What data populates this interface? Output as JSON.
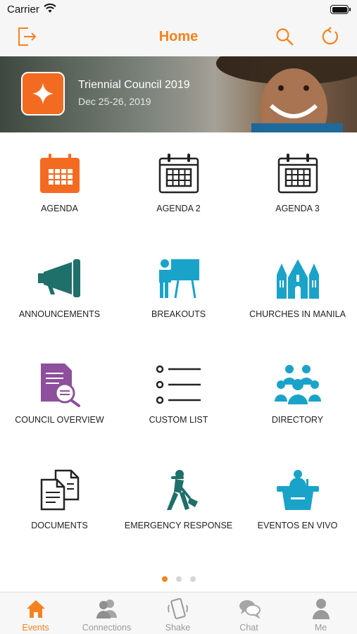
{
  "status_bar": {
    "carrier": "Carrier"
  },
  "nav": {
    "title": "Home"
  },
  "banner": {
    "title": "Triennial Council 2019",
    "date": "Dec 25-26, 2019"
  },
  "tiles": [
    {
      "label": "AGENDA",
      "icon": "calendar-icon",
      "color": "#f36b21"
    },
    {
      "label": "AGENDA 2",
      "icon": "calendar-icon",
      "color": "#222222"
    },
    {
      "label": "AGENDA 3",
      "icon": "calendar-icon",
      "color": "#222222"
    },
    {
      "label": "ANNOUNCEMENTS",
      "icon": "megaphone-icon",
      "color": "#1f6f6b"
    },
    {
      "label": "BREAKOUTS",
      "icon": "presenter-board-icon",
      "color": "#1aa3c9"
    },
    {
      "label": "CHURCHES IN MANILA",
      "icon": "cathedral-icon",
      "color": "#1aa3c9"
    },
    {
      "label": "COUNCIL OVERVIEW",
      "icon": "document-search-icon",
      "color": "#8e4f9c"
    },
    {
      "label": "CUSTOM LIST",
      "icon": "list-icon",
      "color": "#222222"
    },
    {
      "label": "DIRECTORY",
      "icon": "group-icon",
      "color": "#1aa3c9"
    },
    {
      "label": "DOCUMENTS",
      "icon": "documents-icon",
      "color": "#222222"
    },
    {
      "label": "EMERGENCY RESPONSE",
      "icon": "worker-shovel-icon",
      "color": "#1f6f6b"
    },
    {
      "label": "EVENTOS EN VIVO",
      "icon": "podium-icon",
      "color": "#1aa3c9"
    }
  ],
  "pager": {
    "count": 3,
    "active": 1
  },
  "tabs": [
    {
      "label": "Events",
      "icon": "house-icon"
    },
    {
      "label": "Connections",
      "icon": "people-icon"
    },
    {
      "label": "Shake",
      "icon": "shake-phone-icon"
    },
    {
      "label": "Chat",
      "icon": "chat-bubbles-icon"
    },
    {
      "label": "Me",
      "icon": "person-icon"
    }
  ],
  "colors": {
    "accent": "#f5821f",
    "tab_inactive": "#9a9a9a"
  }
}
